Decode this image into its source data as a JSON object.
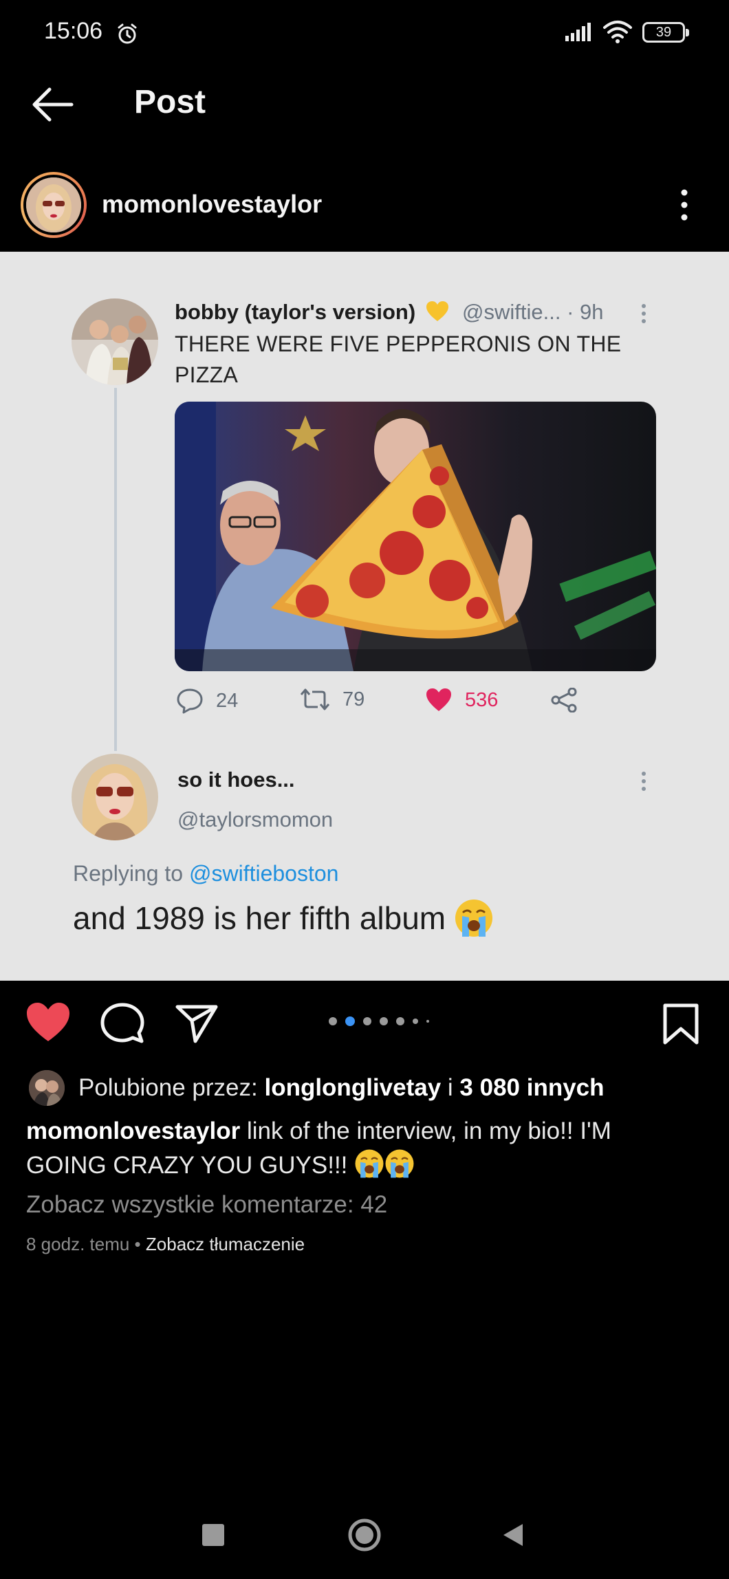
{
  "status_bar": {
    "time": "15:06",
    "battery": "39",
    "icons": [
      "alarm-icon",
      "signal-icon",
      "wifi-icon",
      "battery-icon"
    ]
  },
  "header": {
    "title": "Post",
    "back_icon": "arrow-left-icon"
  },
  "post": {
    "username": "momonlovestaylor",
    "tweet": {
      "name": "bobby (taylor's version)",
      "handle": "@swiftie...",
      "time": "· 9h",
      "text_line1": "THERE WERE FIVE PEPPERONIS ON THE",
      "text_line2": "PIZZA",
      "replies": "24",
      "retweets": "79",
      "likes": "536"
    },
    "reply": {
      "name": "so it hoes...",
      "handle": "@taylorsmomon",
      "replying_prefix": "Replying to",
      "replying_mention": "@swiftieboston",
      "text": "and 1989 is her fifth album"
    }
  },
  "carousel": {
    "dots": 7,
    "active_index": 1
  },
  "liked_by": {
    "prefix": "Polubione przez:",
    "user": "longlonglivetay",
    "connector": "i",
    "others": "3 080 innych"
  },
  "caption": {
    "username": "momonlovestaylor",
    "text": "link of the interview, in my bio!! I'M GOING CRAZY YOU GUYS!!!"
  },
  "view_comments": "Zobacz wszystkie komentarze: 42",
  "timestamp": "8 godz. temu",
  "separator": "•",
  "see_translation": "Zobacz tłumaczenie",
  "colors": {
    "background": "#000000",
    "card": "#e5e5e5",
    "like_red": "#ed4956",
    "twitter_heart": "#e0245e",
    "link_blue": "#1d8fde",
    "carousel_active": "#3b93f5"
  }
}
